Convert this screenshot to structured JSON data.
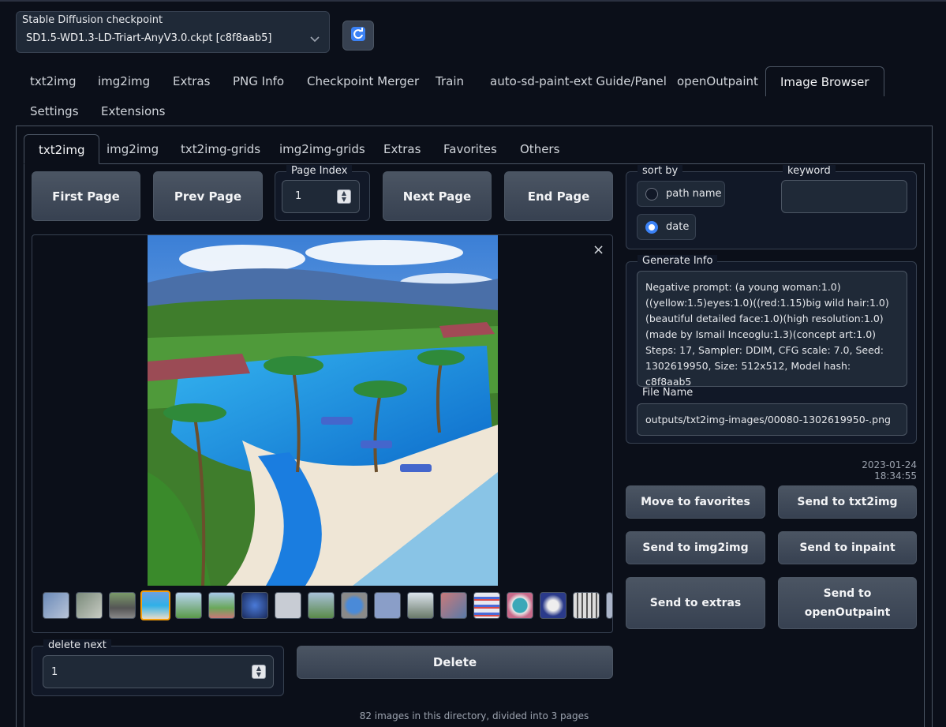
{
  "checkpoint": {
    "label": "Stable Diffusion checkpoint",
    "value": "SD1.5-WD1.3-LD-Triart-AnyV3.0.ckpt [c8f8aab5]"
  },
  "main_tabs": [
    "txt2img",
    "img2img",
    "Extras",
    "PNG Info",
    "Checkpoint Merger",
    "Train",
    "auto-sd-paint-ext Guide/Panel",
    "openOutpaint",
    "Image Browser",
    "Settings",
    "Extensions"
  ],
  "sub_tabs": [
    "txt2img",
    "img2img",
    "txt2img-grids",
    "img2img-grids",
    "Extras",
    "Favorites",
    "Others"
  ],
  "paging": {
    "first": "First Page",
    "prev": "Prev Page",
    "page_index_label": "Page Index",
    "page_index_value": "1",
    "next": "Next Page",
    "end": "End Page"
  },
  "sort": {
    "label": "sort by",
    "options": [
      "path name",
      "date"
    ],
    "selected": "date"
  },
  "keyword": {
    "label": "keyword",
    "value": ""
  },
  "generate_info": {
    "label": "Generate Info",
    "text": "Negative prompt: (a young woman:1.0) ((yellow:1.5)eyes:1.0)((red:1.15)big wild hair:1.0) (beautiful detailed face:1.0)(high resolution:1.0)(made by Ismail Inceoglu:1.3)(concept art:1.0)\nSteps: 17, Sampler: DDIM, CFG scale: 7.0, Seed: 1302619950, Size: 512x512, Model hash: c8f8aab5"
  },
  "file_name": {
    "label": "File Name",
    "value": "outputs/txt2img-images/00080-1302619950-.png"
  },
  "timestamp": "2023-01-24 18:34:55",
  "actions": {
    "move_to_favorites": "Move to favorites",
    "send_txt2img": "Send to txt2img",
    "send_img2img": "Send to img2img",
    "send_inpaint": "Send to inpaint",
    "send_extras": "Send to extras",
    "send_openoutpaint_1": "Send to",
    "send_openoutpaint_2": "openOutpaint"
  },
  "delete": {
    "label": "delete next",
    "value": "1",
    "button": "Delete"
  },
  "footer": "82 images in this directory, divided into 3 pages",
  "close_glyph": "×",
  "colors": {
    "background": "#0b0f19",
    "panel": "#111827",
    "button": "#374151",
    "accent": "#3b82f6",
    "selected_thumb": "#f59e0b"
  }
}
